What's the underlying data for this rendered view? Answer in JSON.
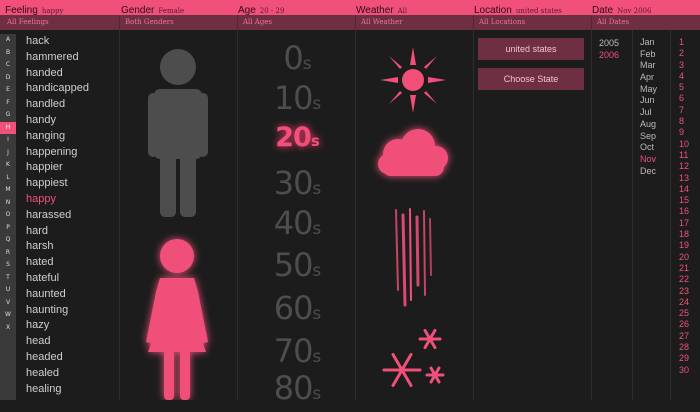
{
  "header": {
    "feeling": {
      "label": "Feeling",
      "value": "happy",
      "all": "All Feelings"
    },
    "gender": {
      "label": "Gender",
      "value": "Female",
      "all": "Both Genders"
    },
    "age": {
      "label": "Age",
      "value": "20 - 29",
      "all": "All Ages"
    },
    "weather": {
      "label": "Weather",
      "value": "All",
      "all": "All Weather"
    },
    "location": {
      "label": "Location",
      "value": "united states",
      "all": "All Locations"
    },
    "date": {
      "label": "Date",
      "value": "Nov 2006",
      "all": "All Dates"
    }
  },
  "alphabet": [
    "A",
    "B",
    "C",
    "D",
    "E",
    "F",
    "G",
    "H",
    "I",
    "J",
    "K",
    "L",
    "M",
    "N",
    "O",
    "P",
    "Q",
    "R",
    "S",
    "T",
    "U",
    "V",
    "W",
    "X"
  ],
  "alphabet_selected": "H",
  "words": [
    "hack",
    "hammered",
    "handed",
    "handicapped",
    "handled",
    "handy",
    "hanging",
    "happening",
    "happier",
    "happiest",
    "happy",
    "harassed",
    "hard",
    "harsh",
    "hated",
    "hateful",
    "haunted",
    "haunting",
    "hazy",
    "head",
    "headed",
    "healed",
    "healing"
  ],
  "word_selected": "happy",
  "ages": [
    {
      "num": "0",
      "suffix": "s"
    },
    {
      "num": "10",
      "suffix": "s"
    },
    {
      "num": "20",
      "suffix": "s"
    },
    {
      "num": "30",
      "suffix": "s"
    },
    {
      "num": "40",
      "suffix": "s"
    },
    {
      "num": "50",
      "suffix": "s"
    },
    {
      "num": "60",
      "suffix": "s"
    },
    {
      "num": "70",
      "suffix": "s"
    },
    {
      "num": "80",
      "suffix": "s"
    }
  ],
  "age_selected": "20",
  "weather_icons": [
    "sun-icon",
    "cloud-icon",
    "rain-icon",
    "snow-icon"
  ],
  "location": {
    "selected_button": "united states",
    "choose_button": "Choose State"
  },
  "years": [
    "2005",
    "2006"
  ],
  "year_selected": "2006",
  "months": [
    "Jan",
    "Feb",
    "Mar",
    "Apr",
    "May",
    "Jun",
    "Jul",
    "Aug",
    "Sep",
    "Oct",
    "Nov",
    "Dec"
  ],
  "month_selected": "Nov",
  "days": [
    "1",
    "2",
    "3",
    "4",
    "5",
    "6",
    "7",
    "8",
    "9",
    "10",
    "11",
    "12",
    "13",
    "14",
    "15",
    "16",
    "17",
    "18",
    "19",
    "20",
    "21",
    "22",
    "23",
    "24",
    "25",
    "26",
    "27",
    "28",
    "29",
    "30"
  ],
  "colors": {
    "accent": "#f0507a",
    "dark_accent": "#6e2f42",
    "background": "#1c1c1c",
    "inactive": "#4d4d4d"
  }
}
